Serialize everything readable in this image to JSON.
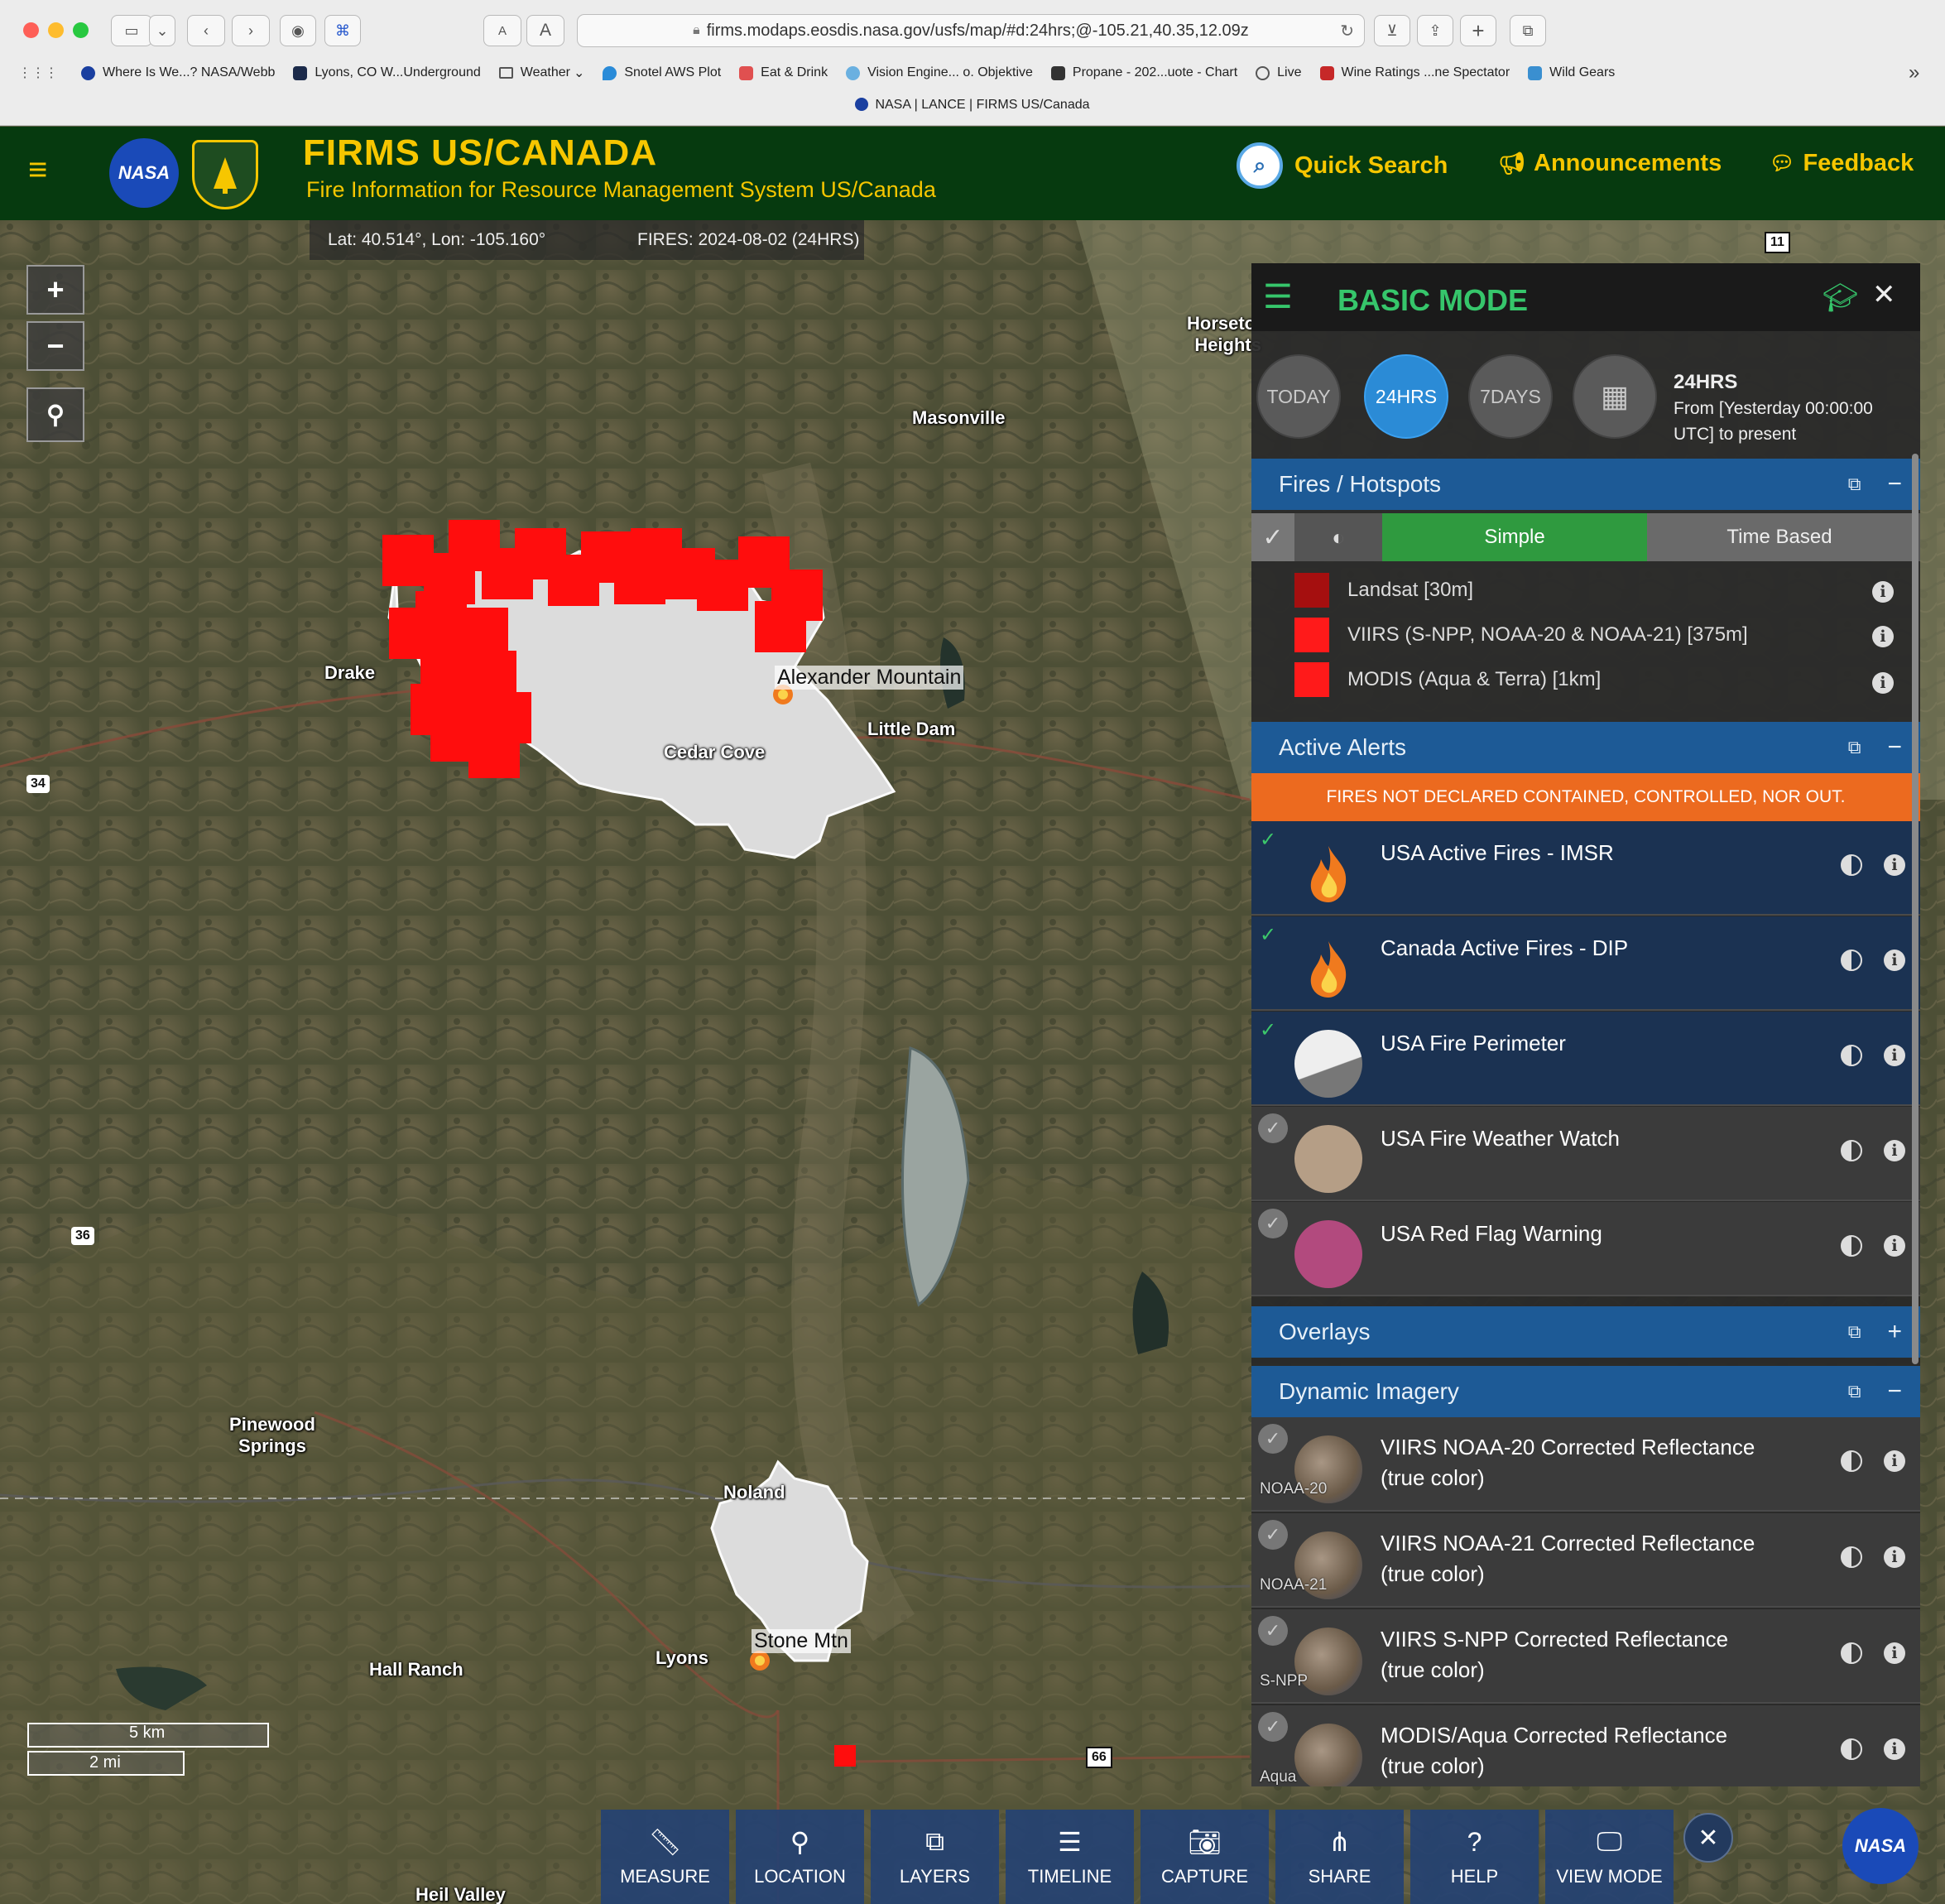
{
  "browser": {
    "url": "firms.modaps.eosdis.nasa.gov/usfs/map/#d:24hrs;@-105.21,40.35,12.09z",
    "tab_title": "NASA | LANCE | FIRMS US/Canada",
    "text_size_small": "A",
    "text_size_large": "A",
    "bookmarks": [
      "Where Is We...? NASA/Webb",
      "Lyons, CO W...Underground",
      "Weather",
      "Snotel AWS Plot",
      "Eat & Drink",
      "Vision Engine... o. Objektive",
      "Propane - 202...uote - Chart",
      "Live",
      "Wine Ratings ...ne Spectator",
      "Wild Gears"
    ],
    "bookmark_more": "»"
  },
  "header": {
    "menu_icon": "≡",
    "nasa_logo": "NASA",
    "title": "FIRMS US/CANADA",
    "subtitle": "Fire Information for Resource Management System US/Canada",
    "quick_search": "Quick Search",
    "announcements": "Announcements",
    "feedback": "Feedback"
  },
  "status": {
    "coords": "Lat: 40.514°, Lon: -105.160°",
    "fires": "FIRES: 2024-08-02 (24HRS)"
  },
  "map": {
    "zoom_in": "+",
    "zoom_out": "−",
    "labels": {
      "drake": "Drake",
      "masonville": "Masonville",
      "horsetooth": "Horsetooth Heights",
      "alexander": "Alexander Mountain",
      "little_dam": "Little Dam",
      "cedar_cove": "Cedar Cove",
      "pinewood": "Pinewood Springs",
      "noland": "Noland",
      "lyons": "Lyons",
      "stone_mtn": "Stone Mtn",
      "hall_ranch": "Hall Ranch",
      "heil_valley": "Heil Valley",
      "hwy34": "34",
      "hwy36": "36",
      "hwy66": "66",
      "hwy11": "11"
    },
    "scale_km": "5 km",
    "scale_mi": "2 mi"
  },
  "panel": {
    "title": "BASIC MODE",
    "close": "✕",
    "time_buttons": [
      "TODAY",
      "24HRS",
      "7DAYS"
    ],
    "time_active": "24HRS",
    "range_title": "24HRS",
    "range_desc": "From [Yesterday 00:00:00 UTC] to present",
    "fires_section": "Fires / Hotspots",
    "mode_simple": "Simple",
    "mode_time": "Time Based",
    "legend": [
      {
        "label": "Landsat [30m]",
        "color": "#a50f0f"
      },
      {
        "label": "VIIRS (S-NPP, NOAA-20 & NOAA-21) [375m]",
        "color": "#ff1a1a"
      },
      {
        "label": "MODIS (Aqua & Terra) [1km]",
        "color": "#ff1a1a"
      }
    ],
    "alerts_section": "Active Alerts",
    "alerts_banner": "FIRES NOT DECLARED CONTAINED, CONTROLLED, NOR OUT.",
    "alerts": [
      {
        "label": "USA Active Fires - IMSR",
        "checked": true
      },
      {
        "label": "Canada Active Fires - DIP",
        "checked": true
      },
      {
        "label": "USA Fire Perimeter",
        "checked": true
      },
      {
        "label": "USA Fire Weather Watch",
        "checked": false
      },
      {
        "label": "USA Red Flag Warning",
        "checked": false
      }
    ],
    "overlays_section": "Overlays",
    "dynamic_section": "Dynamic Imagery",
    "imagery": [
      {
        "label": "VIIRS NOAA-20 Corrected Reflectance (true color)",
        "tag": "NOAA-20"
      },
      {
        "label": "VIIRS NOAA-21 Corrected Reflectance (true color)",
        "tag": "NOAA-21"
      },
      {
        "label": "VIIRS S-NPP Corrected Reflectance (true color)",
        "tag": "S-NPP"
      },
      {
        "label": "MODIS/Aqua Corrected Reflectance (true color)",
        "tag": "Aqua"
      }
    ]
  },
  "toolbar": [
    "MEASURE",
    "LOCATION",
    "LAYERS",
    "TIMELINE",
    "CAPTURE",
    "SHARE",
    "HELP",
    "VIEW MODE"
  ],
  "toolbar_close": "✕",
  "colors": {
    "header_bg": "#063a0f",
    "title_gold": "#f6c600",
    "section_blue": "#1d5a96",
    "banner_orange": "#ec6a1f",
    "accent_green": "#36c66b",
    "active_blue": "#2b8bd6",
    "fire_red": "#ff0d0d"
  }
}
